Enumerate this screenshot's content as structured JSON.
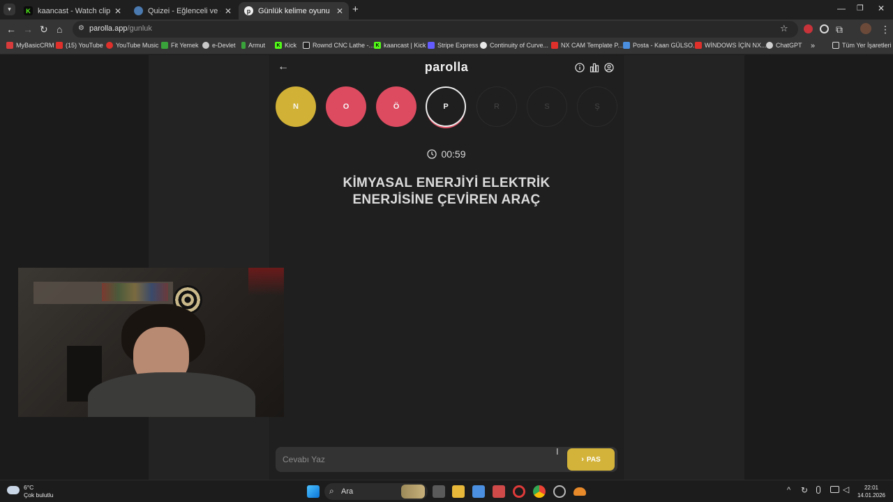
{
  "browser": {
    "tabs": [
      {
        "title": "kaancast - Watch clips on Kick",
        "icon": "kick-icon",
        "active": false
      },
      {
        "title": "Quizei - Eğlenceli ve etkileşimli",
        "icon": "quizei-icon",
        "active": false
      },
      {
        "title": "Günlük kelime oyunu - parolla",
        "icon": "parolla-icon",
        "active": true
      }
    ],
    "url_host": "parolla.app",
    "url_path": "/gunluk",
    "bookmarks": [
      {
        "label": "MyBasicCRM",
        "color": "#d83b3b"
      },
      {
        "label": "(15) YouTube",
        "color": "#e0302b"
      },
      {
        "label": "YouTube Music",
        "color": "#e0302b"
      },
      {
        "label": "Fit Yemek",
        "color": "#3aa23a"
      },
      {
        "label": "e-Devlet",
        "color": "#c9c9c9"
      },
      {
        "label": "Armut",
        "color": "#3aa23a"
      },
      {
        "label": "Kick",
        "color": "#53fc18"
      },
      {
        "label": "Rownd CNC Lathe -...",
        "color": "#222222"
      },
      {
        "label": "kaancast | Kick",
        "color": "#53fc18"
      },
      {
        "label": "Stripe Express",
        "color": "#635bff"
      },
      {
        "label": "Continuity of Curve...",
        "color": "#e8e8e8"
      },
      {
        "label": "NX CAM Template P...",
        "color": "#e0302b"
      },
      {
        "label": "Posta - Kaan GÜLSO...",
        "color": "#4a8fe0"
      },
      {
        "label": "WİNDOWS İÇİN NX...",
        "color": "#e0302b"
      },
      {
        "label": "ChatGPT",
        "color": "#d0d0d0"
      }
    ],
    "all_bookmarks": "Tüm Yer İşaretleri"
  },
  "game": {
    "logo": "parolla",
    "letters": [
      {
        "char": "N",
        "state": "correct"
      },
      {
        "char": "O",
        "state": "wrong"
      },
      {
        "char": "Ö",
        "state": "wrong"
      },
      {
        "char": "P",
        "state": "current"
      },
      {
        "char": "R",
        "state": "pending"
      },
      {
        "char": "S",
        "state": "pending"
      },
      {
        "char": "Ş",
        "state": "pending"
      }
    ],
    "timer": "00:59",
    "question_line1": "KİMYASAL ENERJİYİ ELEKTRİK",
    "question_line2": "ENERJİSİNE ÇEVİREN ARAÇ",
    "answer_placeholder": "Cevabı Yaz",
    "pass_label": "PAS",
    "colors": {
      "correct": "#d1b136",
      "wrong": "#dd4b60",
      "pass_button": "#d3b33a"
    }
  },
  "taskbar": {
    "temperature": "6°C",
    "weather": "Çok bulutlu",
    "search": "Ara",
    "time": "22:01",
    "date": "14.01.2026"
  }
}
